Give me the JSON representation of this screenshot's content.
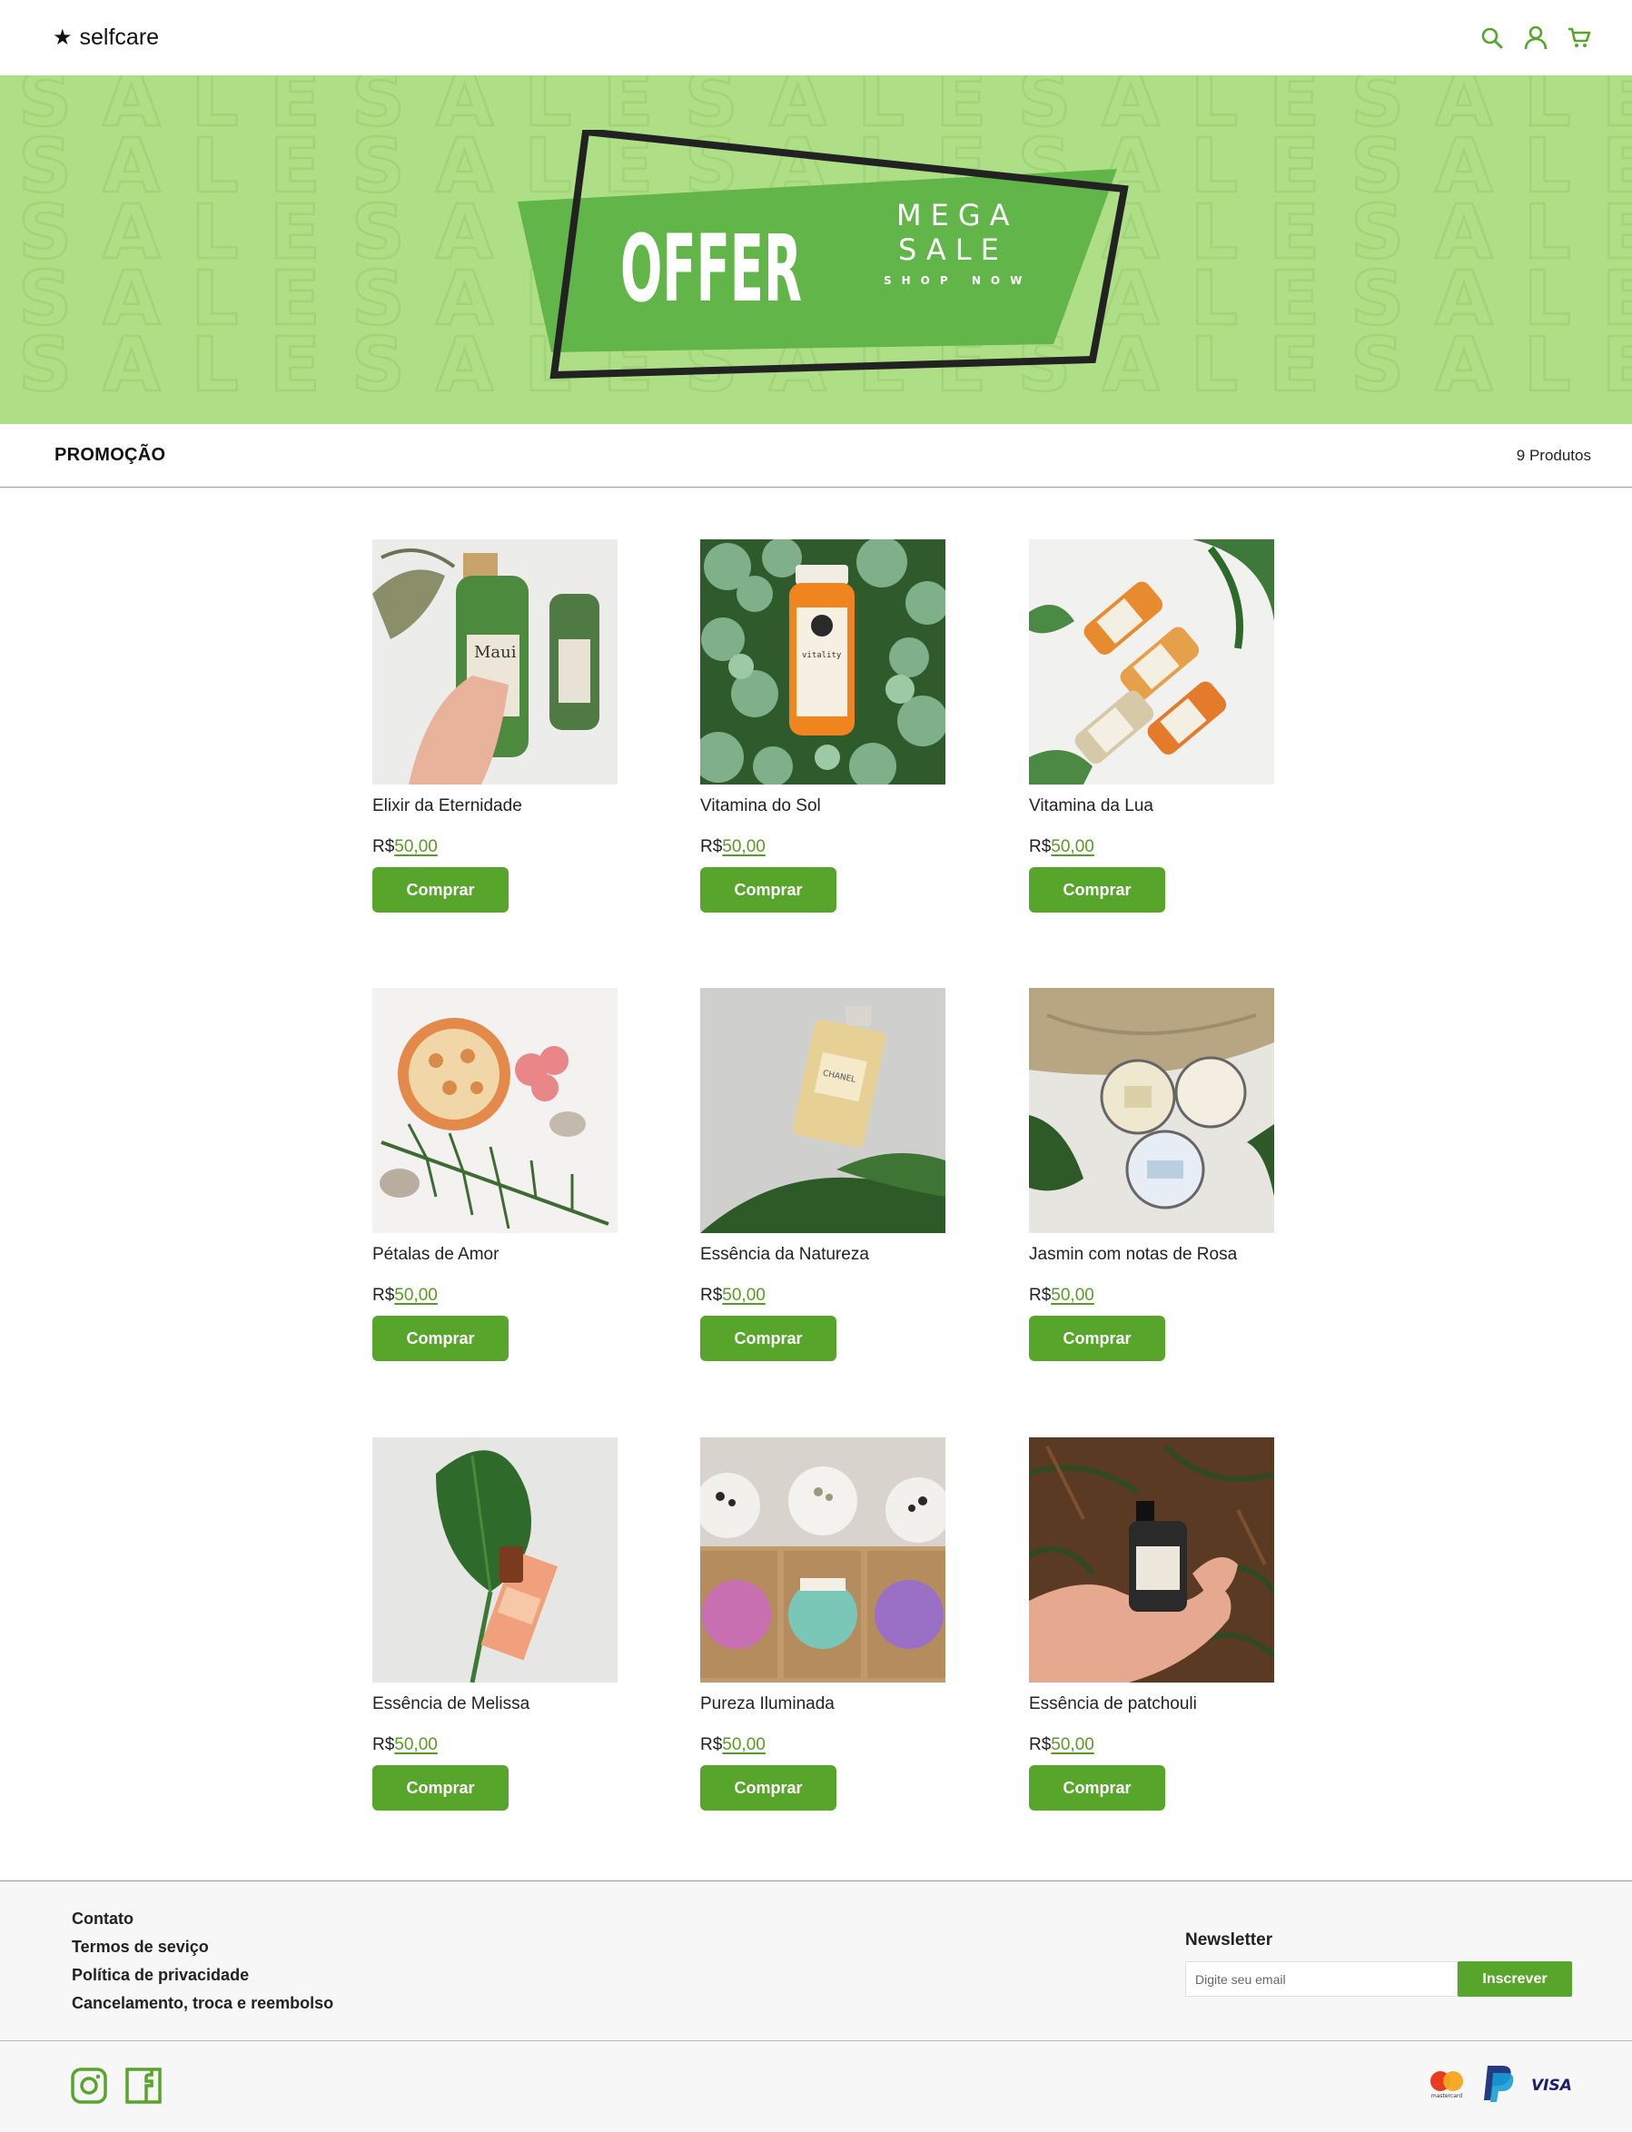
{
  "header": {
    "brand": "selfcare",
    "icons": [
      "search-icon",
      "user-icon",
      "cart-icon"
    ]
  },
  "banner": {
    "main": "OFFER",
    "line1": "MEGA",
    "line2": "SALE",
    "line3": "SHOP NOW",
    "background_word": "SALE"
  },
  "section": {
    "title": "PROMOÇÃO",
    "count": "9 Produtos"
  },
  "products": [
    {
      "name": "Elixir da Eternidade",
      "currency": "R$",
      "price": "50,00",
      "button": "Comprar"
    },
    {
      "name": "Vitamina do Sol",
      "currency": "R$",
      "price": "50,00",
      "button": "Comprar"
    },
    {
      "name": "Vitamina da Lua",
      "currency": "R$",
      "price": "50,00",
      "button": "Comprar"
    },
    {
      "name": "Pétalas de Amor",
      "currency": "R$",
      "price": "50,00",
      "button": "Comprar"
    },
    {
      "name": "Essência da Natureza",
      "currency": "R$",
      "price": "50,00",
      "button": "Comprar"
    },
    {
      "name": "Jasmin com notas de Rosa",
      "currency": "R$",
      "price": "50,00",
      "button": "Comprar"
    },
    {
      "name": "Essência de Melissa",
      "currency": "R$",
      "price": "50,00",
      "button": "Comprar"
    },
    {
      "name": "Pureza Iluminada",
      "currency": "R$",
      "price": "50,00",
      "button": "Comprar"
    },
    {
      "name": "Essência de patchouli",
      "currency": "R$",
      "price": "50,00",
      "button": "Comprar"
    }
  ],
  "footer": {
    "links": [
      "Contato",
      "Termos de seviço",
      "Política de privacidade",
      "Cancelamento, troca e reembolso"
    ],
    "newsletter": {
      "title": "Newsletter",
      "placeholder": "Digite seu email",
      "button": "Inscrever"
    },
    "social": [
      "instagram-icon",
      "facebook-icon"
    ],
    "payments": [
      "mastercard",
      "paypal",
      "VISA"
    ]
  },
  "colors": {
    "accent": "#57a52a",
    "banner_bg": "#aedf86",
    "banner_green": "#62b548"
  }
}
